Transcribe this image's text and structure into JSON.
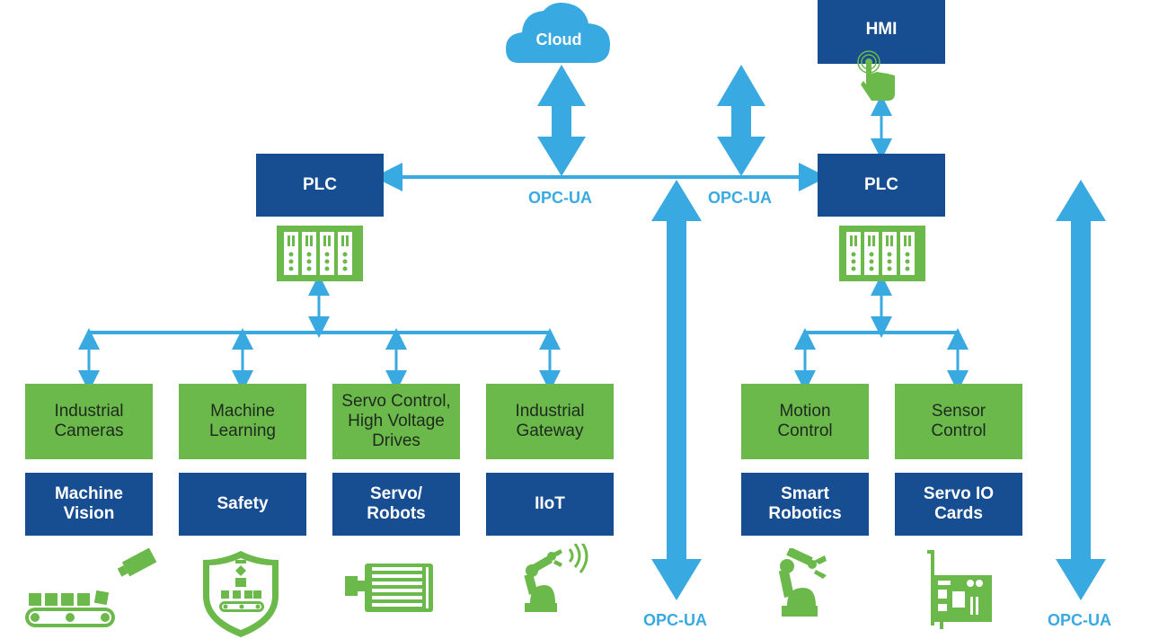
{
  "colors": {
    "dark_blue": "#174d91",
    "green": "#6ab94a",
    "arrow_blue": "#39a9e1",
    "white": "#ffffff"
  },
  "cloud": {
    "label": "Cloud"
  },
  "hmi": {
    "label": "HMI",
    "icon": "touch-hand-icon"
  },
  "plc_left": {
    "label": "PLC",
    "icon": "plc-rack-icon"
  },
  "plc_right": {
    "label": "PLC",
    "icon": "plc-rack-icon"
  },
  "protocol_labels": {
    "bus_left": "OPC-UA",
    "bus_right": "OPC-UA",
    "bottom_center": "OPC-UA",
    "bottom_right": "OPC-UA"
  },
  "left_group": [
    {
      "function": "Industrial Cameras",
      "application": "Machine Vision",
      "icon": "conveyor-camera-icon"
    },
    {
      "function": "Machine Learning",
      "application": "Safety",
      "icon": "safety-shield-icon"
    },
    {
      "function": "Servo Control, High Voltage Drives",
      "application": "Servo/ Robots",
      "icon": "servo-motor-icon"
    },
    {
      "function": "Industrial Gateway",
      "application": "IIoT",
      "icon": "wireless-robot-arm-icon"
    }
  ],
  "right_group": [
    {
      "function": "Motion Control",
      "application": "Smart Robotics",
      "icon": "robot-arm-icon"
    },
    {
      "function": "Sensor Control",
      "application": "Servo IO Cards",
      "icon": "io-card-icon"
    }
  ]
}
